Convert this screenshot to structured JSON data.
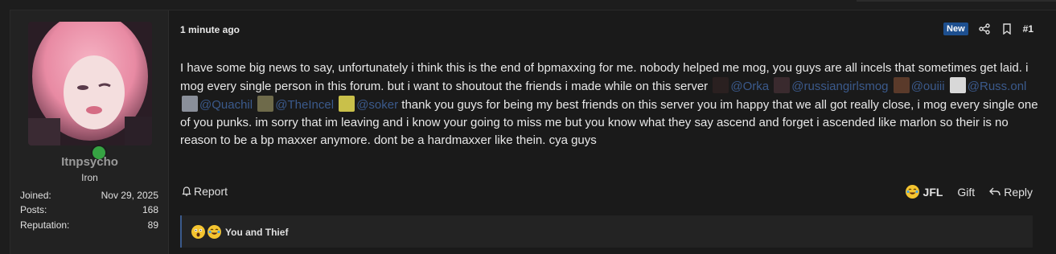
{
  "user": {
    "username": "Itnpsycho",
    "title": "Iron",
    "stats": [
      {
        "label": "Joined:",
        "value": "Nov 29, 2025"
      },
      {
        "label": "Posts:",
        "value": "168"
      },
      {
        "label": "Reputation:",
        "value": "89"
      }
    ]
  },
  "post": {
    "time": "1 minute ago",
    "badge": "New",
    "number": "#1",
    "text1": "I have some big news to say, unfortunately i think this is the end of bpmaxxing for me. nobody helped me mog, you guys are all incels that sometimes get laid. i mog every single person in this forum. but i want to shoutout the friends i made while on this server",
    "mentions": [
      "@Orka",
      "@russiangirlsmog",
      "@ouiii",
      "@Russ.onl",
      "@Quachil",
      "@TheIncel",
      "@soker"
    ],
    "text2": "thank you guys for being my best friends on this server you im happy that we all got really close, i mog every single one of you punks. im sorry that im leaving and i know your going to miss me but you know what they say ascend and forget i ascended like marlon so their is no reason to be a bp maxxer anymore. dont be a hardmaxxer like thein. cya guys"
  },
  "footer": {
    "report": "Report",
    "jfl": "JFL",
    "gift": "Gift",
    "reply": "Reply"
  },
  "reactions": {
    "text": "You and Thief",
    "emojis": [
      "astonished-emoji",
      "joy-emoji"
    ]
  },
  "colors": {
    "accent": "#3b5a8c",
    "badge": "#1d4f8f",
    "online": "#36a343"
  }
}
